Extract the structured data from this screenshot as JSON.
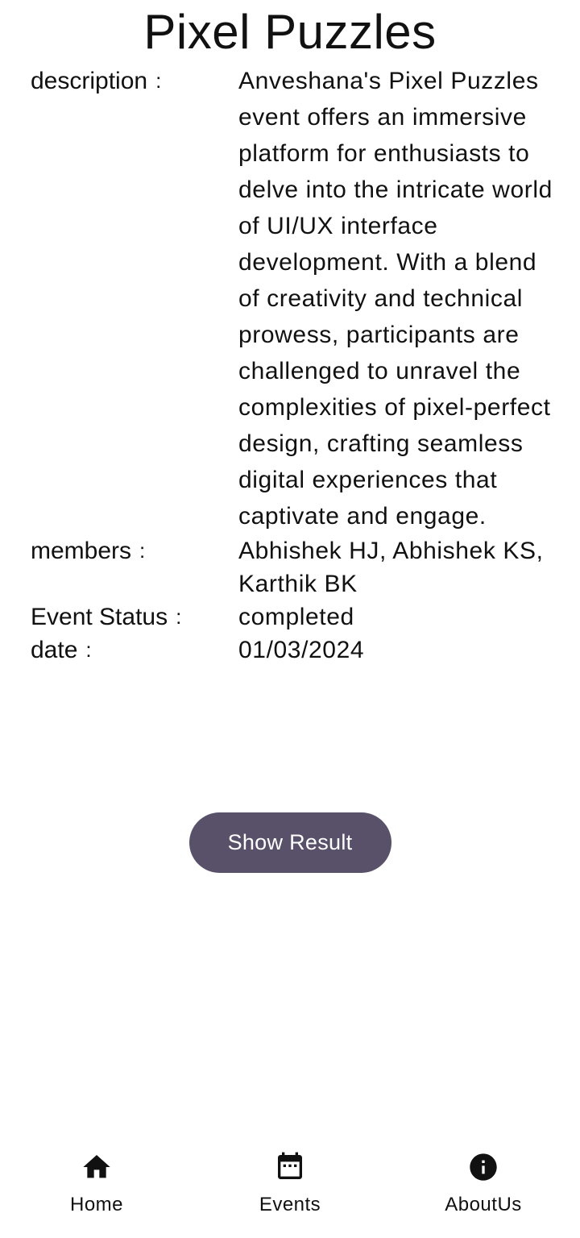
{
  "header": {
    "title": "Pixel Puzzles"
  },
  "details": {
    "separator": ":",
    "description": {
      "label": "description",
      "value": "Anveshana's Pixel Puzzles event offers an immersive platform for enthusiasts to delve into the intricate world of UI/UX interface development. With a blend of creativity and technical prowess, participants are challenged to unravel the complexities of pixel-perfect design, crafting seamless digital experiences that captivate and engage."
    },
    "members": {
      "label": "members",
      "value": "Abhishek HJ, Abhishek KS, Karthik BK"
    },
    "status": {
      "label": "Event Status",
      "value": "completed"
    },
    "date": {
      "label": "date",
      "value": "01/03/2024"
    }
  },
  "actions": {
    "show_result_label": "Show Result"
  },
  "nav": {
    "items": [
      {
        "label": "Home",
        "icon": "home-icon"
      },
      {
        "label": "Events",
        "icon": "calendar-icon"
      },
      {
        "label": "AboutUs",
        "icon": "info-icon"
      }
    ]
  },
  "colors": {
    "button_bg": "#59506a",
    "button_text": "#ffffff",
    "text": "#111111",
    "background": "#ffffff"
  }
}
